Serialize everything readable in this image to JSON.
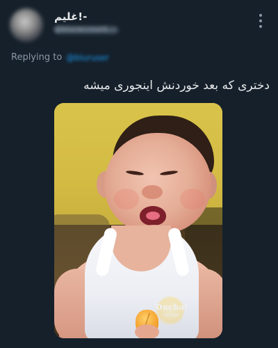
{
  "theme": {
    "background": "#15202b",
    "text_primary": "#e7e9ea",
    "text_secondary": "#8b98a5",
    "link": "#1d9bf0"
  },
  "tweet": {
    "display_name": "غلیم!-",
    "handle": "@bluraccount",
    "replying_label": "Replying to",
    "replying_to": "@bluruser",
    "text": "دختری که بعد خوردنش اینجوری میشه",
    "more_icon": "more-vertical-icon"
  },
  "media": {
    "watermark_text": "Duchal",
    "watermark_subtext": "PICTURE"
  }
}
